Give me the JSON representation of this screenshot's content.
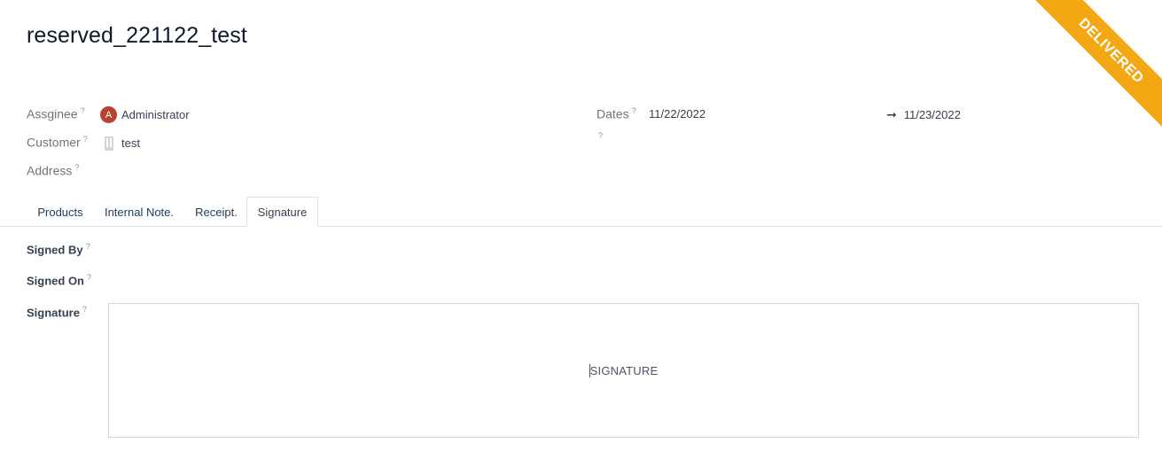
{
  "record": {
    "title": "reserved_221122_test",
    "status_ribbon": "DELIVERED"
  },
  "fields": {
    "assignee_label": "Assginee",
    "assignee_avatar_letter": "A",
    "assignee_value": "Administrator",
    "customer_label": "Customer",
    "customer_value": "test",
    "address_label": "Address",
    "dates_label": "Dates",
    "date_start": "11/22/2022",
    "date_end": "11/23/2022",
    "help_mark": "?"
  },
  "tabs": [
    {
      "label": "Products"
    },
    {
      "label": "Internal Note."
    },
    {
      "label": "Receipt."
    },
    {
      "label": "Signature",
      "active": true
    }
  ],
  "signature_tab": {
    "signed_by_label": "Signed By",
    "signed_on_label": "Signed On",
    "signature_label": "Signature",
    "signature_placeholder": "SIGNATURE"
  },
  "colors": {
    "ribbon": "#f3a712",
    "avatar": "#b5432f"
  },
  "icons": {
    "customer": "building-icon",
    "date_range": "arrow-right-icon"
  }
}
